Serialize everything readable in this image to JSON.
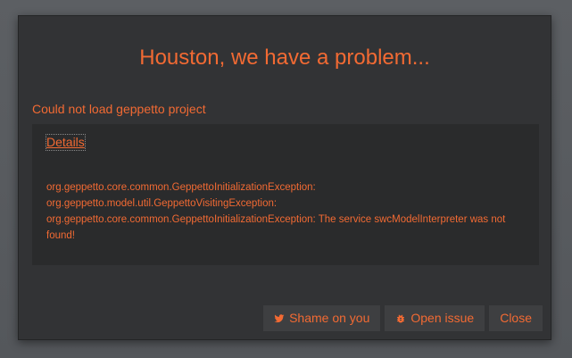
{
  "dialog": {
    "title": "Houston, we have a problem...",
    "message": "Could not load geppetto project",
    "details_label": "Details",
    "details_text": "org.geppetto.core.common.GeppettoInitializationException: org.geppetto.model.util.GeppettoVisitingException: org.geppetto.core.common.GeppettoInitializationException: The service swcModelInterpreter was not found!"
  },
  "buttons": {
    "shame": {
      "label": "Shame on you",
      "icon": "twitter-icon"
    },
    "issue": {
      "label": "Open issue",
      "icon": "bug-icon"
    },
    "close": {
      "label": "Close"
    }
  },
  "colors": {
    "accent": "#f26a33",
    "modal_bg": "#323335",
    "details_bg": "#2a2b2c",
    "button_bg": "#3e3f41",
    "backdrop": "#585b5f"
  }
}
